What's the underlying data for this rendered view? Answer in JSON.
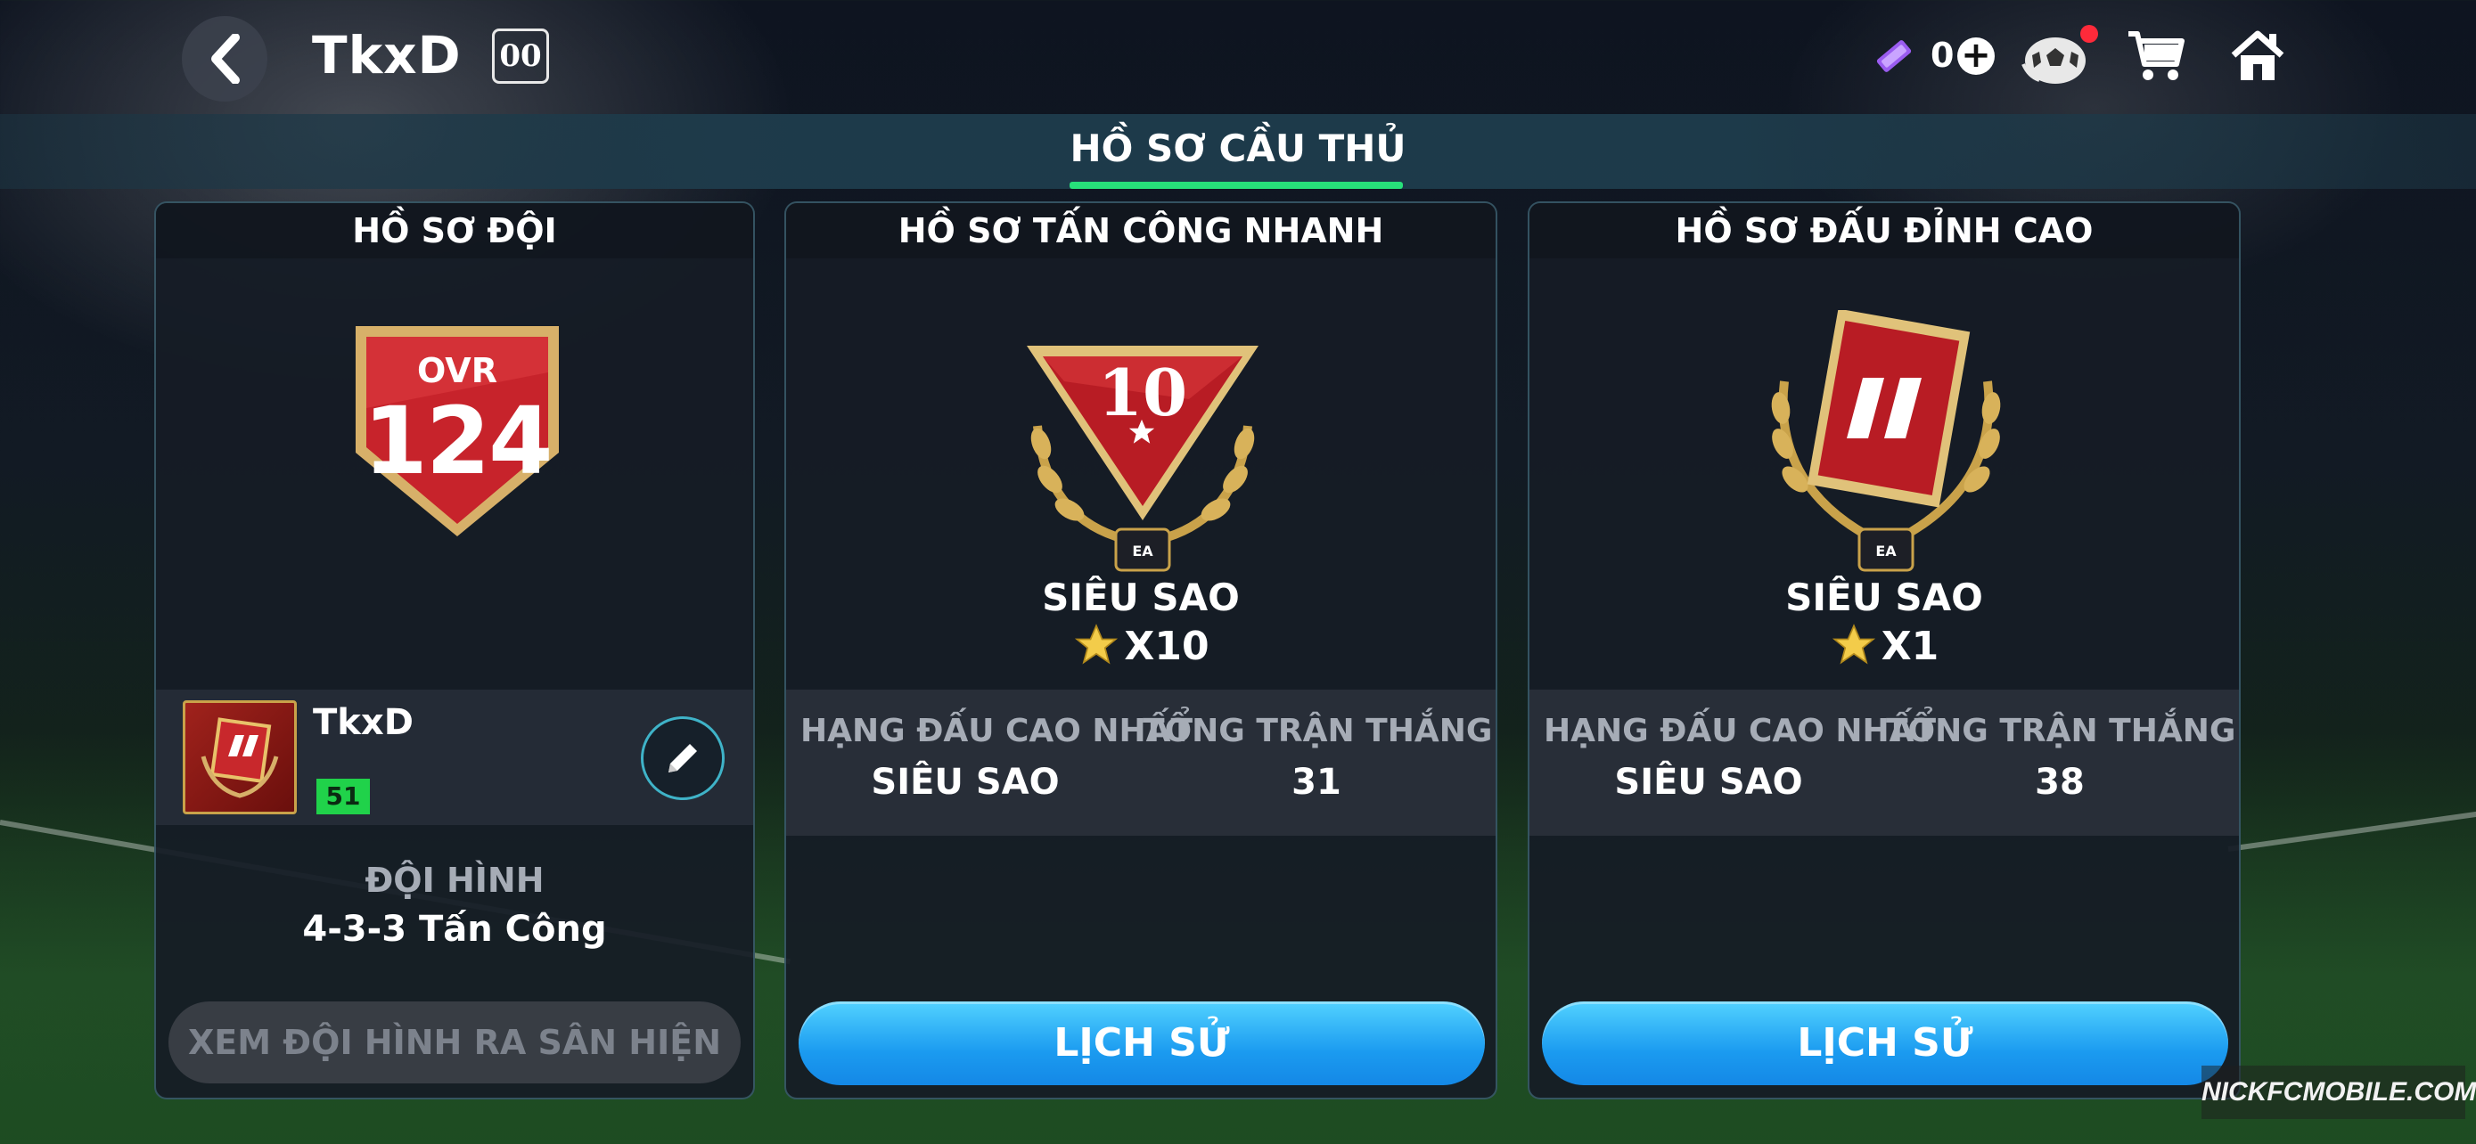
{
  "header": {
    "team_name": "TkxD",
    "team_badge": "00",
    "currency_value": "0"
  },
  "title": "HỒ SƠ CẦU THỦ",
  "team_profile": {
    "header": "HỒ SƠ ĐỘI",
    "ovr_label": "OVR",
    "ovr_value": "124",
    "player_name": "TkxD",
    "level": "51",
    "formation_label": "ĐỘI HÌNH",
    "formation_value": "4-3-3 Tấn Công",
    "lineup_button": "XEM ĐỘI HÌNH RA SÂN HIỆN TẠI"
  },
  "modes": [
    {
      "header": "HỒ SƠ TẤN CÔNG NHANH",
      "trophy_number": "10",
      "rank": "SIÊU SAO",
      "stars": "X10",
      "best_rank_label": "HẠNG ĐẤU CAO NHẤT",
      "best_rank_value": "SIÊU SAO",
      "wins_label": "TỔNG TRẬN THẮNG",
      "wins_value": "31",
      "history_button": "LỊCH SỬ"
    },
    {
      "header": "HỒ SƠ ĐẤU ĐỈNH CAO",
      "rank": "SIÊU SAO",
      "stars": "X1",
      "best_rank_label": "HẠNG ĐẤU CAO NHẤT",
      "best_rank_value": "SIÊU SAO",
      "wins_label": "TỔNG TRẬN THẮNG",
      "wins_value": "38",
      "history_button": "LỊCH SỬ"
    }
  ],
  "watermark": "NICKFCMOBILE.COM",
  "colors": {
    "accent_green": "#27e07a",
    "button_blue": "#1b9bf0",
    "level_green": "#20d24a",
    "badge_red": "#c0262a",
    "gold": "#c9a24a"
  },
  "icons": {
    "back": "chevron-left-icon",
    "currency": "ticket-icon",
    "add": "plus-icon",
    "ball": "ball-icon",
    "cart": "cart-icon",
    "home": "home-icon",
    "edit": "pencil-icon",
    "star": "star-icon"
  }
}
